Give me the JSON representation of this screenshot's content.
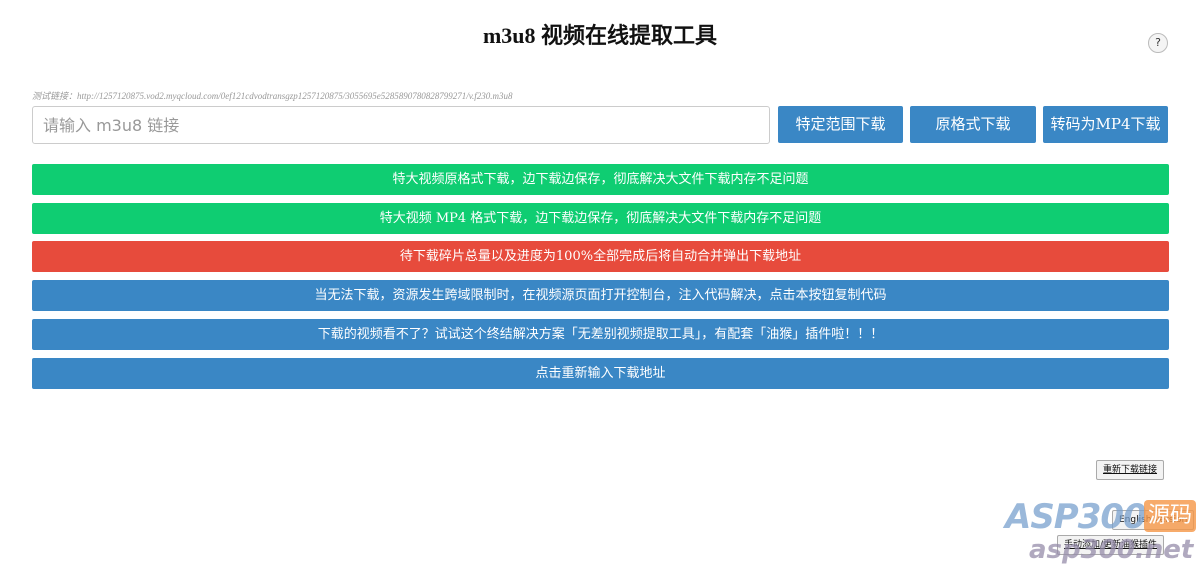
{
  "header": {
    "title": "m3u8 视频在线提取工具",
    "help_label": "?"
  },
  "input": {
    "test_link": "测试链接：http://1257120875.vod2.myqcloud.com/0ef121cdvodtransgzp1257120875/3055695e5285890780828799271/v.f230.m3u8",
    "placeholder": "请输入 m3u8 链接",
    "value": ""
  },
  "buttons": {
    "range_download": "特定范围下载",
    "original_download": "原格式下载",
    "convert_mp4": "转码为MP4下载"
  },
  "bars": [
    {
      "label": "特大视频原格式下载，边下载边保存，彻底解决大文件下载内存不足问题",
      "color": "#0fcd72"
    },
    {
      "label": "特大视频 MP4 格式下载，边下载边保存，彻底解决大文件下载内存不足问题",
      "color": "#0fcd72"
    },
    {
      "label": "待下载碎片总量以及进度为100%全部完成后将自动合并弹出下载地址",
      "color": "#e74b3c"
    },
    {
      "label": "当无法下载，资源发生跨域限制时，在视频源页面打开控制台，注入代码解决，点击本按钮复制代码",
      "color": "#3a87c5"
    },
    {
      "label": "下载的视频看不了？试试这个终结解决方案「无差别视频提取工具」，有配套「油猴」插件啦！！！",
      "color": "#3a87c5"
    },
    {
      "label": "点击重新输入下载地址",
      "color": "#3a87c5"
    }
  ],
  "floating": {
    "reload_link": "重新下载链接",
    "english_version": "English version",
    "plugin": "手动添加/更新油猴插件"
  },
  "watermark": {
    "brand": "ASP300",
    "tag": "源码",
    "url": "asp300.net"
  }
}
